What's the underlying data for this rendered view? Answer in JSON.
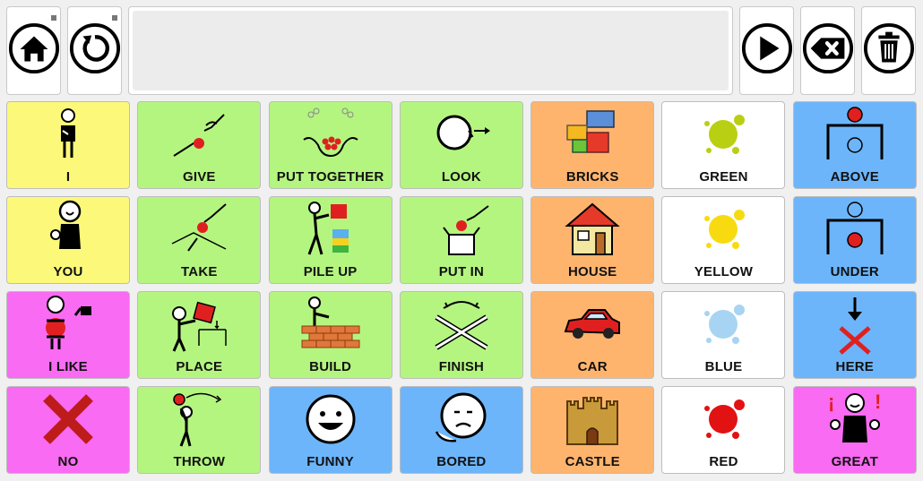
{
  "toolbar": {
    "left": [
      {
        "name": "home-button",
        "icon": "home-icon"
      },
      {
        "name": "refresh-button",
        "icon": "refresh-icon"
      }
    ],
    "right": [
      {
        "name": "speak-button",
        "icon": "play-icon"
      },
      {
        "name": "backspace-button",
        "icon": "backspace-icon"
      },
      {
        "name": "clear-button",
        "icon": "trash-icon"
      }
    ]
  },
  "message_bar": {
    "text": ""
  },
  "colors": {
    "yellow": "#fcf97a",
    "green": "#b4f580",
    "orange": "#ffb46e",
    "white": "#ffffff",
    "blue": "#6db5fa",
    "pink": "#f86bf2"
  },
  "cells": [
    {
      "label": "I",
      "color": "yellow",
      "icon": "person-me-icon"
    },
    {
      "label": "GIVE",
      "color": "green",
      "icon": "give-hands-icon"
    },
    {
      "label": "PUT TOGETHER",
      "color": "green",
      "icon": "put-together-icon"
    },
    {
      "label": "LOOK",
      "color": "green",
      "icon": "look-icon"
    },
    {
      "label": "BRICKS",
      "color": "orange",
      "icon": "bricks-icon"
    },
    {
      "label": "GREEN",
      "color": "white",
      "icon": "green-splash-icon"
    },
    {
      "label": "ABOVE",
      "color": "blue",
      "icon": "above-icon"
    },
    {
      "label": "YOU",
      "color": "yellow",
      "icon": "person-you-icon"
    },
    {
      "label": "TAKE",
      "color": "green",
      "icon": "take-icon"
    },
    {
      "label": "PILE UP",
      "color": "green",
      "icon": "pile-up-icon"
    },
    {
      "label": "PUT IN",
      "color": "green",
      "icon": "put-in-icon"
    },
    {
      "label": "HOUSE",
      "color": "orange",
      "icon": "house-icon"
    },
    {
      "label": "YELLOW",
      "color": "white",
      "icon": "yellow-splash-icon"
    },
    {
      "label": "UNDER",
      "color": "blue",
      "icon": "under-icon"
    },
    {
      "label": "I LIKE",
      "color": "pink",
      "icon": "i-like-icon"
    },
    {
      "label": "PLACE",
      "color": "green",
      "icon": "place-icon"
    },
    {
      "label": "BUILD",
      "color": "green",
      "icon": "build-icon"
    },
    {
      "label": "FINISH",
      "color": "green",
      "icon": "finish-icon"
    },
    {
      "label": "CAR",
      "color": "orange",
      "icon": "car-icon"
    },
    {
      "label": "BLUE",
      "color": "white",
      "icon": "blue-splash-icon"
    },
    {
      "label": "HERE",
      "color": "blue",
      "icon": "here-icon"
    },
    {
      "label": "NO",
      "color": "pink",
      "icon": "no-cross-icon"
    },
    {
      "label": "THROW",
      "color": "green",
      "icon": "throw-icon"
    },
    {
      "label": "FUNNY",
      "color": "blue",
      "icon": "funny-face-icon"
    },
    {
      "label": "BORED",
      "color": "blue",
      "icon": "bored-face-icon"
    },
    {
      "label": "CASTLE",
      "color": "orange",
      "icon": "castle-icon"
    },
    {
      "label": "RED",
      "color": "white",
      "icon": "red-splash-icon"
    },
    {
      "label": "GREAT",
      "color": "pink",
      "icon": "great-icon"
    }
  ]
}
